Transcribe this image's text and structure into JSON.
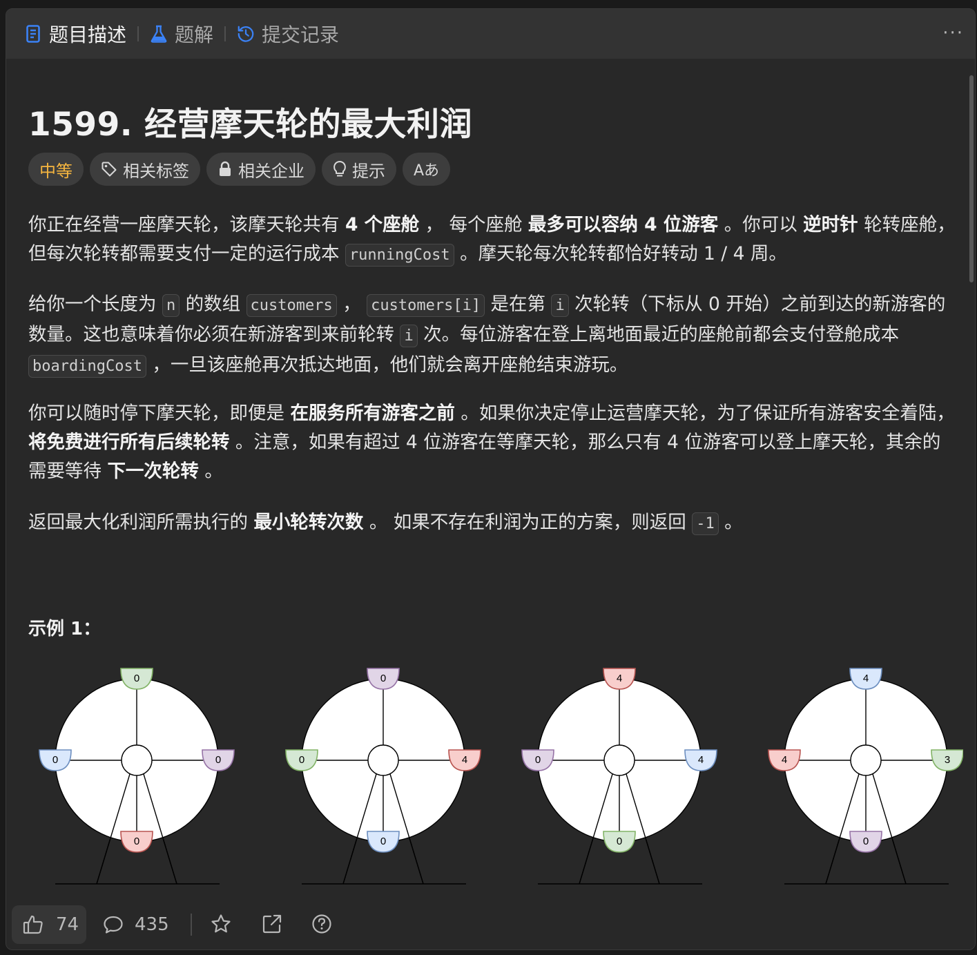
{
  "tabs": [
    {
      "label": "题目描述",
      "icon": "description-icon"
    },
    {
      "label": "题解",
      "icon": "flask-icon"
    },
    {
      "label": "提交记录",
      "icon": "history-icon"
    }
  ],
  "more_label": "···",
  "problem": {
    "title": "1599. 经营摩天轮的最大利润"
  },
  "tags": {
    "difficulty": "中等",
    "related_tags": "相关标签",
    "related_companies": "相关企业",
    "hints": "提示",
    "font": "Aあ"
  },
  "description": {
    "p1": {
      "t1": "你正在经营一座摩天轮，该摩天轮共有 ",
      "b1": "4 个座舱",
      "t2": " ， 每个座舱 ",
      "b2": "最多可以容纳 4 位游客",
      "t3": " 。你可以 ",
      "b3": "逆时针",
      "t4": " 轮转座舱，但每次轮转都需要支付一定的运行成本 ",
      "c1": "runningCost",
      "t5": " 。摩天轮每次轮转都恰好转动 1 / 4 周。"
    },
    "p2": {
      "t1": "给你一个长度为 ",
      "c1": "n",
      "t2": " 的数组 ",
      "c2": "customers",
      "t3": " ， ",
      "c3": "customers[i]",
      "t4": " 是在第 ",
      "c4": "i",
      "t5": " 次轮转（下标从 0 开始）之前到达的新游客的数量。这也意味着你必须在新游客到来前轮转 ",
      "c5": "i",
      "t6": " 次。每位游客在登上离地面最近的座舱前都会支付登舱成本 ",
      "c6": "boardingCost",
      "t7": " ，一旦该座舱再次抵达地面，他们就会离开座舱结束游玩。"
    },
    "p3": {
      "t1": "你可以随时停下摩天轮，即便是 ",
      "b1": "在服务所有游客之前",
      "t2": " 。如果你决定停止运营摩天轮，为了保证所有游客安全着陆，",
      "b2": "将免费进行所有后续轮转",
      "t3": " 。注意，如果有超过 4 位游客在等摩天轮，那么只有 4 位游客可以登上摩天轮，其余的需要等待 ",
      "b3": "下一次轮转",
      "t4": " 。"
    },
    "p4": {
      "t1": "返回最大化利润所需执行的 ",
      "b1": "最小轮转次数",
      "t2": " 。 如果不存在利润为正的方案，则返回 ",
      "c1": "-1",
      "t3": " 。"
    }
  },
  "example": {
    "title": "示例 1："
  },
  "wheels": [
    {
      "gondolas": [
        {
          "pos": "top",
          "value": "0",
          "color": "green"
        },
        {
          "pos": "right",
          "value": "0",
          "color": "purple"
        },
        {
          "pos": "bottom",
          "value": "0",
          "color": "red"
        },
        {
          "pos": "left",
          "value": "0",
          "color": "blue"
        }
      ]
    },
    {
      "gondolas": [
        {
          "pos": "top",
          "value": "0",
          "color": "purple"
        },
        {
          "pos": "right",
          "value": "4",
          "color": "red"
        },
        {
          "pos": "bottom",
          "value": "0",
          "color": "blue"
        },
        {
          "pos": "left",
          "value": "0",
          "color": "green"
        }
      ]
    },
    {
      "gondolas": [
        {
          "pos": "top",
          "value": "4",
          "color": "red"
        },
        {
          "pos": "right",
          "value": "4",
          "color": "blue"
        },
        {
          "pos": "bottom",
          "value": "0",
          "color": "green"
        },
        {
          "pos": "left",
          "value": "0",
          "color": "purple"
        }
      ]
    },
    {
      "gondolas": [
        {
          "pos": "top",
          "value": "4",
          "color": "blue"
        },
        {
          "pos": "right",
          "value": "3",
          "color": "green"
        },
        {
          "pos": "bottom",
          "value": "0",
          "color": "purple"
        },
        {
          "pos": "left",
          "value": "4",
          "color": "red"
        }
      ]
    }
  ],
  "gondola_colors": {
    "green": {
      "fill": "#d5e8d4",
      "stroke": "#82b366"
    },
    "purple": {
      "fill": "#e1d5e7",
      "stroke": "#9673a6"
    },
    "red": {
      "fill": "#f8cecc",
      "stroke": "#b85450"
    },
    "blue": {
      "fill": "#dae8fc",
      "stroke": "#6c8ebf"
    }
  },
  "bottom": {
    "likes": "74",
    "comments": "435"
  },
  "colors": {
    "background": "#282828",
    "tabbar": "#333333",
    "difficulty_medium": "#f5b53f",
    "tab_icon_active": "#3b82f6"
  }
}
